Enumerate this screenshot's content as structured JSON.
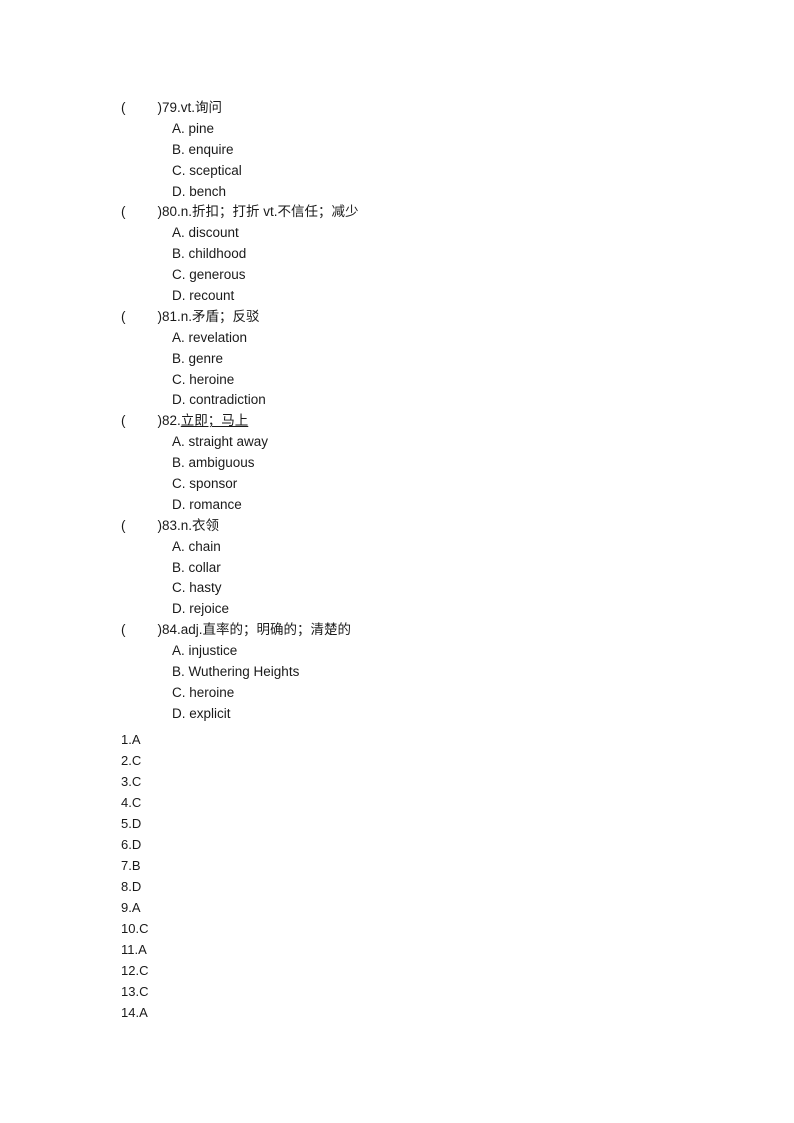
{
  "document": {
    "type": "vocabulary-multiple-choice-worksheet",
    "language": "zh-CN/en"
  },
  "questions": [
    {
      "open_paren": "(",
      "close_paren": ")",
      "number": "79.",
      "prompt": "vt.询问",
      "underlined": false,
      "options": [
        "A. pine",
        "B. enquire",
        "C. sceptical",
        "D. bench"
      ]
    },
    {
      "open_paren": "(",
      "close_paren": ")",
      "number": "80.",
      "prompt": "n.折扣；打折  vt.不信任；减少",
      "underlined": false,
      "options": [
        "A. discount",
        "B. childhood",
        "C. generous",
        "D. recount"
      ]
    },
    {
      "open_paren": "(",
      "close_paren": ")",
      "number": "81.",
      "prompt": "n.矛盾；反驳",
      "underlined": false,
      "options": [
        "A. revelation",
        "B. genre",
        "C. heroine",
        "D. contradiction"
      ]
    },
    {
      "open_paren": "(",
      "close_paren": ")",
      "number": "82.",
      "prompt": "立即；马上",
      "underlined": true,
      "options": [
        "A. straight away",
        "B. ambiguous",
        "C. sponsor",
        "D. romance"
      ]
    },
    {
      "open_paren": "(",
      "close_paren": ")",
      "number": "83.",
      "prompt": "n.衣领",
      "underlined": false,
      "options": [
        "A. chain",
        "B. collar",
        "C. hasty",
        "D. rejoice"
      ]
    },
    {
      "open_paren": "(",
      "close_paren": ")",
      "number": "84.",
      "prompt": "adj.直率的；明确的；清楚的",
      "underlined": false,
      "options": [
        "A. injustice",
        "B. Wuthering Heights",
        "C. heroine",
        "D. explicit"
      ]
    }
  ],
  "answer_key": [
    "1.A",
    "2.C",
    "3.C",
    "4.C",
    "5.D",
    "6.D",
    "7.B",
    "8.D",
    "9.A",
    "10.C",
    "11.A",
    "12.C",
    "13.C",
    "14.A"
  ]
}
